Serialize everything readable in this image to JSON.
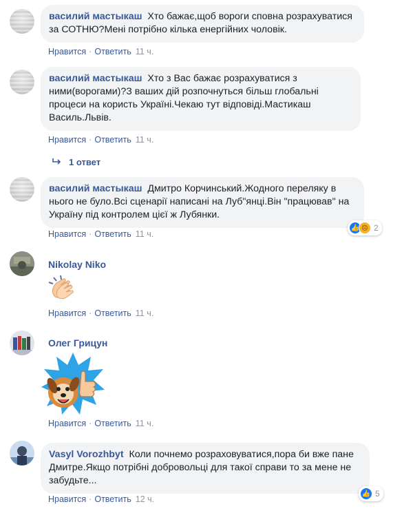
{
  "comments": [
    {
      "author": "василий мастыкаш",
      "text": "Хто бажає,щоб вороги сповна розрахуватися за СОТНЮ?Мені потрібно кілька енергійних чоловік.",
      "like": "Нравится",
      "reply": "Ответить",
      "time": "11 ч."
    },
    {
      "author": "василий мастыкаш",
      "text": "Хто з Вас бажає розрахуватися з ними(ворогами)?З ваших дій розпочнуться більш глобальні процеси на користь Україні.Чекаю тут відповіді.Мастикаш Василь.Львів.",
      "like": "Нравится",
      "reply": "Ответить",
      "time": "11 ч.",
      "replies_label": "1 ответ"
    },
    {
      "author": "василий мастыкаш",
      "text": "Дмитро Корчинський.Жодного переляку в нього не було.Всі сценарії написані на Луб\"янці.Він \"працював\" на Україну під контролем цієї ж Лубянки.",
      "like": "Нравится",
      "reply": "Ответить",
      "time": "11 ч.",
      "reactions": {
        "icons": [
          "like-icon",
          "sad-icon"
        ],
        "count": "2"
      }
    },
    {
      "author": "Nikolay Niko",
      "sticker": "clapping-hands-icon",
      "like": "Нравится",
      "reply": "Ответить",
      "time": "11 ч."
    },
    {
      "author": "Олег Грицун",
      "sticker": "dog-thumbs-up-sticker",
      "like": "Нравится",
      "reply": "Ответить",
      "time": "11 ч."
    },
    {
      "author": "Vasyl Vorozhbyt",
      "text": "Коли почнемо розраховуватися,пора би вже пане Дмитре.Якщо потрібні добровольці для такої справи то за мене не забудьте...",
      "like": "Нравится",
      "reply": "Ответить",
      "time": "12 ч.",
      "reactions": {
        "icons": [
          "like-icon"
        ],
        "count": "5"
      }
    }
  ],
  "colors": {
    "link": "#385898",
    "bubble": "#f2f3f5",
    "meta": "#90949c",
    "like": "#1877f2"
  }
}
